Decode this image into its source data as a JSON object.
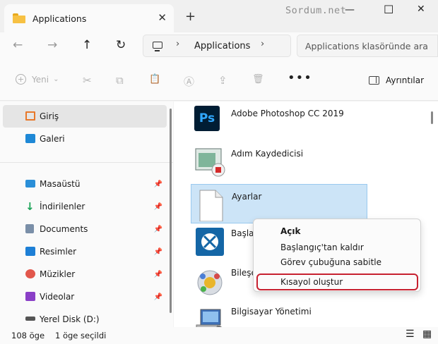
{
  "window": {
    "tab_title": "Applications",
    "watermark": "Sordum.net",
    "close_tab_glyph": "✕",
    "new_tab_glyph": "+",
    "minimize_glyph": "—",
    "maximize_glyph": "☐",
    "close_glyph": "✕"
  },
  "address": {
    "back_glyph": "←",
    "forward_glyph": "→",
    "up_glyph": "↑",
    "refresh_glyph": "↻",
    "sep_glyph": "›",
    "crumb": "Applications",
    "search_placeholder": "Applications klasöründe ara"
  },
  "toolbar": {
    "new_label": "Yeni",
    "new_chevron": "⌄",
    "more_glyph": "•••",
    "details_label": "Ayrıntılar",
    "cut_glyph": "✂",
    "copy_glyph": "⧉",
    "paste_glyph": "📋",
    "rename_glyph": "Ⓐ",
    "share_glyph": "⇪",
    "delete_glyph": "🗑"
  },
  "sidebar": {
    "pin_glyph": "📌",
    "items": [
      {
        "label": "Giriş",
        "icon": "home-icon",
        "color": "#e8782a"
      },
      {
        "label": "Galeri",
        "icon": "gallery-icon",
        "color": "#1e88d6"
      },
      {
        "label": "Masaüstü",
        "icon": "desktop-icon",
        "color": "#2a8fd8"
      },
      {
        "label": "İndirilenler",
        "icon": "download-icon",
        "color": "#1aa357"
      },
      {
        "label": "Documents",
        "icon": "documents-icon",
        "color": "#7a8fa8"
      },
      {
        "label": "Resimler",
        "icon": "pictures-icon",
        "color": "#1d7fd6"
      },
      {
        "label": "Müzikler",
        "icon": "music-icon",
        "color": "#e2574c"
      },
      {
        "label": "Videolar",
        "icon": "videos-icon",
        "color": "#8a3fc7"
      },
      {
        "label": "Yerel Disk (D:)",
        "icon": "drive-icon",
        "color": "#555555"
      }
    ]
  },
  "files": [
    {
      "name": "Adobe Photoshop CC 2019",
      "icon": "photoshop-icon"
    },
    {
      "name": "Adım Kaydedicisi",
      "icon": "steps-recorder-icon"
    },
    {
      "name": "Ayarlar",
      "icon": "blank-file-icon"
    },
    {
      "name": "Başlar",
      "icon": "start-app-icon"
    },
    {
      "name": "Bileşe",
      "icon": "components-icon"
    },
    {
      "name": "Bilgisayar Yönetimi",
      "icon": "computer-management-icon"
    }
  ],
  "photoshop_badge": "Ps",
  "context_menu": {
    "open": "Açık",
    "unpin_start": "Başlangıç'tan kaldır",
    "pin_taskbar": "Görev çubuğuna sabitle",
    "create_shortcut": "Kısayol oluştur"
  },
  "status": {
    "count": "108 öge",
    "selected": "1 öge seçildi",
    "list_view_glyph": "☰",
    "grid_view_glyph": "▦"
  }
}
